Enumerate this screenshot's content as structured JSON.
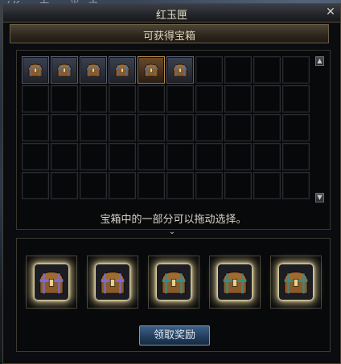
{
  "window": {
    "title": "红玉匣",
    "close_symbol": "✕",
    "background_text": "(K  ·  力  ·  半  之  ·  ·  ·"
  },
  "section": {
    "title": "可获得宝箱"
  },
  "grid": {
    "columns": 10,
    "rows": 5,
    "items": [
      {
        "icon": "chest-icon",
        "state": "filled"
      },
      {
        "icon": "chest-icon",
        "state": "filled"
      },
      {
        "icon": "chest-icon",
        "state": "filled"
      },
      {
        "icon": "chest-icon",
        "state": "filled"
      },
      {
        "icon": "chest-icon",
        "state": "highlight"
      },
      {
        "icon": "chest-icon",
        "state": "filled"
      }
    ]
  },
  "scroll": {
    "up_symbol": "▲",
    "down_symbol": "▼"
  },
  "hint": "宝箱中的一部分可以拖动选择。",
  "expand_symbol": "⌄",
  "rewards": [
    {
      "icon": "purple-chest-icon",
      "tint": "#7d6bd0"
    },
    {
      "icon": "purple-chest-icon",
      "tint": "#7d6bd0"
    },
    {
      "icon": "teal-chest-icon",
      "tint": "#3d8a84"
    },
    {
      "icon": "teal-chest-icon",
      "tint": "#3d8a84"
    },
    {
      "icon": "teal-chest-icon",
      "tint": "#3d8a84"
    }
  ],
  "claim_button": "领取奖励",
  "colors": {
    "accent_gold": "#e7dcc0",
    "button_blue": "#23405f",
    "glow": "#fff6d0"
  }
}
